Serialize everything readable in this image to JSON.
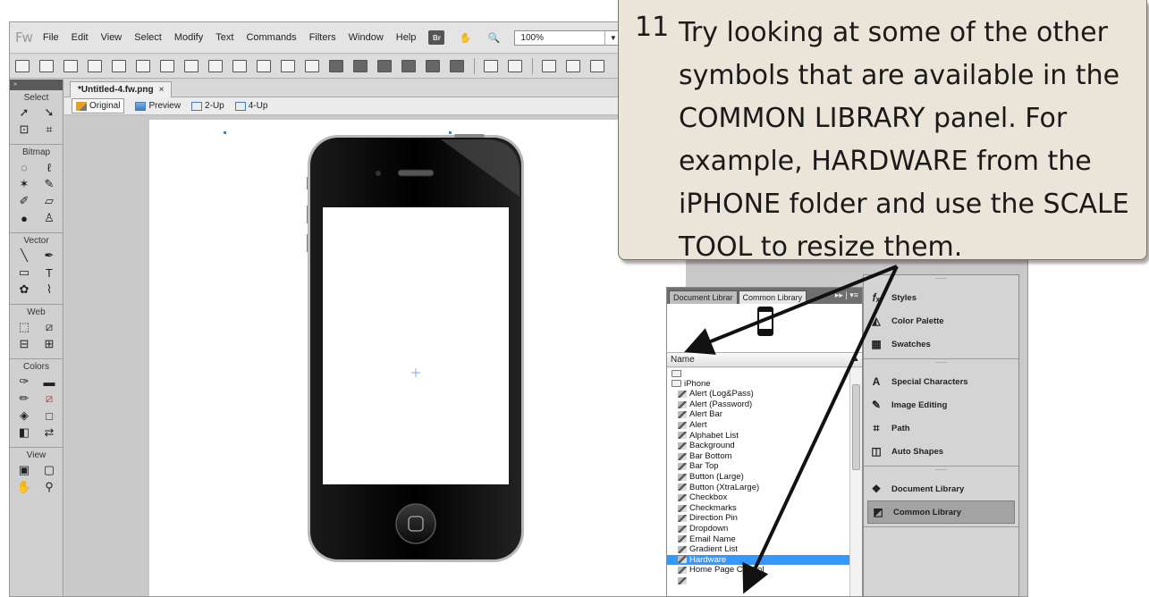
{
  "app": {
    "logo": "Fw",
    "menus": [
      "File",
      "Edit",
      "View",
      "Select",
      "Modify",
      "Text",
      "Commands",
      "Filters",
      "Window",
      "Help"
    ],
    "bridge_label": "Br",
    "zoom": "100%"
  },
  "document": {
    "tab_title": "*Untitled-4.fw.png",
    "tab_close": "×",
    "views": [
      "Original",
      "Preview",
      "2-Up",
      "4-Up"
    ]
  },
  "tools": {
    "grip": "»",
    "sections": {
      "select": "Select",
      "bitmap": "Bitmap",
      "vector": "Vector",
      "web": "Web",
      "colors": "Colors",
      "view": "View"
    }
  },
  "library": {
    "tabs": [
      "Document Librar",
      "Common Library"
    ],
    "tab_controls": "▸▸ | ▾≡",
    "column_name": "Name",
    "items": [
      {
        "label": "",
        "type": "folder",
        "level": 0
      },
      {
        "label": "iPhone",
        "type": "folder",
        "level": 0
      },
      {
        "label": "Alert (Log&Pass)",
        "type": "symbol",
        "level": 1
      },
      {
        "label": "Alert (Password)",
        "type": "symbol",
        "level": 1
      },
      {
        "label": "Alert Bar",
        "type": "symbol",
        "level": 1
      },
      {
        "label": "Alert",
        "type": "symbol",
        "level": 1
      },
      {
        "label": "Alphabet List",
        "type": "symbol",
        "level": 1
      },
      {
        "label": "Background",
        "type": "symbol",
        "level": 1
      },
      {
        "label": "Bar Bottom",
        "type": "symbol",
        "level": 1
      },
      {
        "label": "Bar Top",
        "type": "symbol",
        "level": 1
      },
      {
        "label": "Button (Large)",
        "type": "symbol",
        "level": 1
      },
      {
        "label": "Button (XtraLarge)",
        "type": "symbol",
        "level": 1
      },
      {
        "label": "Checkbox",
        "type": "symbol",
        "level": 1
      },
      {
        "label": "Checkmarks",
        "type": "symbol",
        "level": 1
      },
      {
        "label": "Direction Pin",
        "type": "symbol",
        "level": 1
      },
      {
        "label": "Dropdown",
        "type": "symbol",
        "level": 1
      },
      {
        "label": "Email Name",
        "type": "symbol",
        "level": 1
      },
      {
        "label": "Gradient List",
        "type": "symbol",
        "level": 1
      },
      {
        "label": "Hardware",
        "type": "symbol",
        "level": 1,
        "selected": true
      },
      {
        "label": "Home Page Control",
        "type": "symbol",
        "level": 1
      },
      {
        "label": "",
        "type": "symbol",
        "level": 1
      }
    ]
  },
  "dock": {
    "groups": [
      [
        {
          "label": "Styles",
          "icon": "fx-icon"
        },
        {
          "label": "Color Palette",
          "icon": "color-palette-icon"
        },
        {
          "label": "Swatches",
          "icon": "swatches-icon"
        }
      ],
      [
        {
          "label": "Special Characters",
          "icon": "special-characters-icon"
        },
        {
          "label": "Image Editing",
          "icon": "image-editing-icon"
        },
        {
          "label": "Path",
          "icon": "path-icon"
        },
        {
          "label": "Auto Shapes",
          "icon": "auto-shapes-icon"
        }
      ],
      [
        {
          "label": "Document Library",
          "icon": "document-library-icon"
        },
        {
          "label": "Common Library",
          "icon": "common-library-icon",
          "active": true
        }
      ]
    ]
  },
  "callout": {
    "number": "11",
    "text": "Try looking at some of the other symbols that are available in the COMMON LIBRARY panel.  For example, HARDWARE from the iPHONE folder and use the SCALE TOOL to resize them."
  },
  "colors": {
    "selection": "#3399ff",
    "callout_bg": "#ebe4d8",
    "app_bg": "#d4d4d4"
  }
}
